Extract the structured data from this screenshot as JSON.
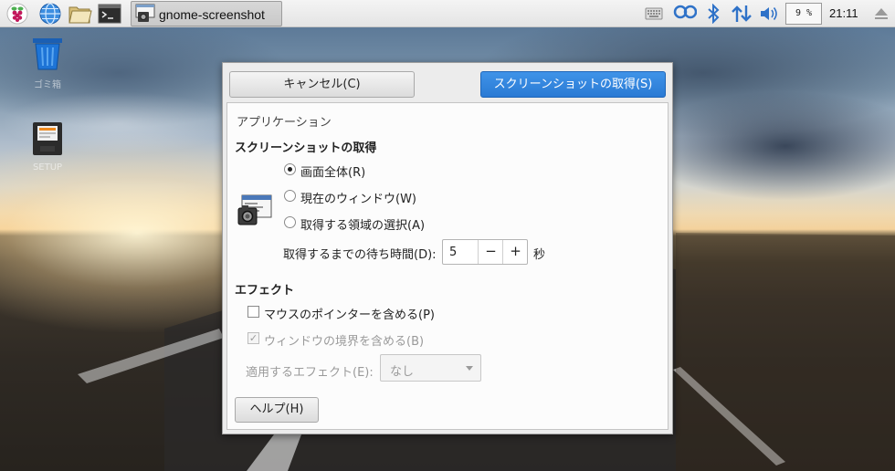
{
  "taskbar": {
    "task_title": "gnome-screenshot",
    "cpu_usage": "9 %",
    "clock": "21:11"
  },
  "desktop": {
    "icons": [
      {
        "name": "trash",
        "label": "ゴミ箱"
      },
      {
        "name": "sd-card",
        "label": "SETUP"
      }
    ]
  },
  "dialog": {
    "cancel_label": "キャンセル(C)",
    "take_label": "スクリーンショットの取得(S)",
    "app_section": "アプリケーション",
    "take_heading": "スクリーンショットの取得",
    "options": [
      {
        "label": "画面全体(R)",
        "selected": true
      },
      {
        "label": "現在のウィンドウ(W)",
        "selected": false
      },
      {
        "label": "取得する領域の選択(A)",
        "selected": false
      }
    ],
    "delay_label": "取得するまでの待ち時間(D):",
    "delay_value": "5",
    "delay_unit": "秒",
    "effects_heading": "エフェクト",
    "include_pointer_label": "マウスのポインターを含める(P)",
    "include_border_label": "ウィンドウの境界を含める(B)",
    "apply_effect_label": "適用するエフェクト(E):",
    "apply_effect_value": "なし",
    "help_label": "ヘルプ(H)"
  }
}
